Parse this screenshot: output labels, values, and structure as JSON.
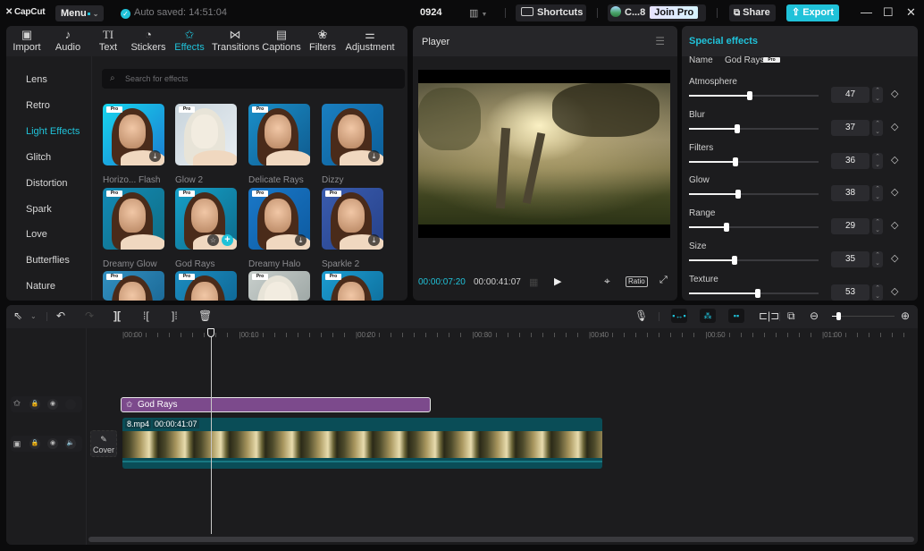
{
  "titlebar": {
    "app_name": "CapCut",
    "menu_label": "Menu",
    "autosave": "Auto saved: 14:51:04",
    "project_name": "0924",
    "layout_icon": "layout-icon",
    "shortcuts_label": "Shortcuts",
    "account_label": "C...8",
    "join_pro_label": "Join Pro",
    "share_label": "Share",
    "export_label": "Export",
    "accent_color": "#20c2d9"
  },
  "media_tabs": [
    {
      "label": "Import",
      "icon": "▣"
    },
    {
      "label": "Audio",
      "icon": "♪"
    },
    {
      "label": "Text",
      "icon": "TI"
    },
    {
      "label": "Stickers",
      "icon": "◔"
    },
    {
      "label": "Effects",
      "icon": "✩",
      "active": true
    },
    {
      "label": "Transitions",
      "icon": "⋈"
    },
    {
      "label": "Captions",
      "icon": "▤"
    },
    {
      "label": "Filters",
      "icon": "❀"
    },
    {
      "label": "Adjustment",
      "icon": "⚌"
    }
  ],
  "categories": [
    "Lens",
    "Retro",
    "Light Effects",
    "Glitch",
    "Distortion",
    "Spark",
    "Love",
    "Butterflies",
    "Nature"
  ],
  "active_category": "Light Effects",
  "search": {
    "placeholder": "Search for effects"
  },
  "effects": [
    {
      "name": "Horizo... Flash",
      "pro": true,
      "state": "download"
    },
    {
      "name": "Glow 2",
      "pro": true,
      "state": "none"
    },
    {
      "name": "Delicate Rays",
      "pro": true,
      "state": "none"
    },
    {
      "name": "Dizzy",
      "pro": false,
      "state": "download"
    },
    {
      "name": "Dreamy Glow",
      "pro": true,
      "state": "none"
    },
    {
      "name": "God Rays",
      "pro": true,
      "state": "added"
    },
    {
      "name": "Dreamy Halo",
      "pro": true,
      "state": "download"
    },
    {
      "name": "Sparkle 2",
      "pro": true,
      "state": "download"
    },
    {
      "name": "",
      "pro": true,
      "state": "none"
    },
    {
      "name": "",
      "pro": true,
      "state": "none"
    },
    {
      "name": "",
      "pro": true,
      "state": "none"
    },
    {
      "name": "",
      "pro": true,
      "state": "none"
    }
  ],
  "pro_badge": "Pro",
  "player": {
    "title": "Player",
    "current_time": "00:00:07:20",
    "total_time": "00:00:41:07",
    "ratio_label": "Ratio"
  },
  "properties": {
    "title": "Special effects",
    "name_label": "Name",
    "name_value": "God Rays",
    "params": [
      {
        "label": "Atmosphere",
        "value": 47
      },
      {
        "label": "Blur",
        "value": 37
      },
      {
        "label": "Filters",
        "value": 36
      },
      {
        "label": "Glow",
        "value": 38
      },
      {
        "label": "Range",
        "value": 29
      },
      {
        "label": "Size",
        "value": 35
      },
      {
        "label": "Texture",
        "value": 53
      }
    ],
    "slider_max": 100
  },
  "timeline": {
    "ruler_labels": [
      "00:00",
      "00:10",
      "00:20",
      "00:30",
      "00:40",
      "00:50",
      "01:00"
    ],
    "effect_clip": {
      "label": "God Rays"
    },
    "video_clip": {
      "filename": "8.mp4",
      "duration": "00:00:41:07"
    },
    "cover_label": "Cover",
    "zoom_level": 0.1
  }
}
